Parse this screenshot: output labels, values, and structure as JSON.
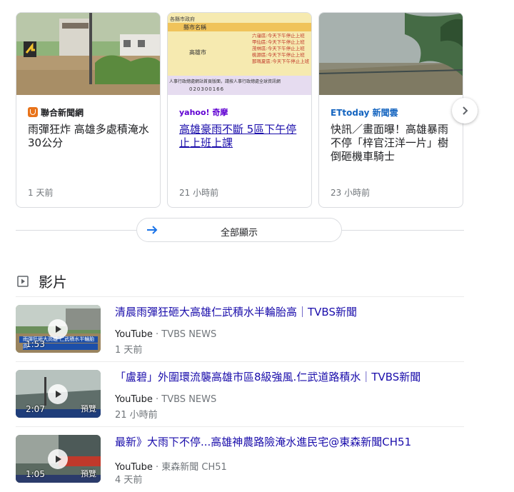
{
  "news": {
    "cards": [
      {
        "source": "聯合新聞網",
        "headline": "雨彈狂炸 高雄多處積淹水30公分",
        "age": "1 天前"
      },
      {
        "source": "yahoo! 奇摩",
        "headline": "高雄豪雨不斷 5區下午停止上班上課",
        "age": "21 小時前",
        "notice": {
          "header": "各縣市政府",
          "column_header": "縣市名稱",
          "city": "高雄市",
          "districts": [
            "六龜區:今天下午停止上班",
            "甲仙區:今天下午停止上班",
            "茂林區:今天下午停止上班",
            "桃源區:今天下午停止上班",
            "那瑪夏區:今天下午停止上班"
          ],
          "footer_note": "人事行政總處網站首頁版面，請按人事行政總處全球資訊網",
          "phone": "020300166"
        }
      },
      {
        "source": "ETtoday 新聞雲",
        "headline": "快訊／畫面曝！高雄暴雨不停「梓官汪洋一片」樹倒砸機車騎士",
        "age": "23 小時前"
      }
    ],
    "next_icon": "chevron-right-icon"
  },
  "show_all": {
    "label": "全部顯示",
    "icon": "arrow-right-icon"
  },
  "videos_section": {
    "title": "影片",
    "icon": "play-square-icon",
    "items": [
      {
        "title": "清晨雨彈狂砸大高雄仁武積水半輪胎高｜TVBS新聞",
        "platform": "YouTube",
        "channel": "TVBS NEWS",
        "age": "1 天前",
        "duration": "1:53",
        "overlay_text": "雨彈狂砸大高雄 仁武積水半輪胎高"
      },
      {
        "title": "「盧碧」外圍環流襲高雄市區8級強風.仁武道路積水｜TVBS新聞",
        "platform": "YouTube",
        "channel": "TVBS NEWS",
        "age": "21 小時前",
        "duration": "2:07",
        "overlay_text": "預覽"
      },
      {
        "title": "最新》大雨下不停...高雄神農路險淹水進民宅@東森新聞CH51",
        "platform": "YouTube",
        "channel": "東森新聞 CH51",
        "age": "4 天前",
        "duration": "1:05",
        "overlay_text": "預覽"
      }
    ]
  },
  "colors": {
    "link": "#1a0dab",
    "text": "#202124",
    "meta": "#70757a",
    "border": "#dadce0"
  }
}
